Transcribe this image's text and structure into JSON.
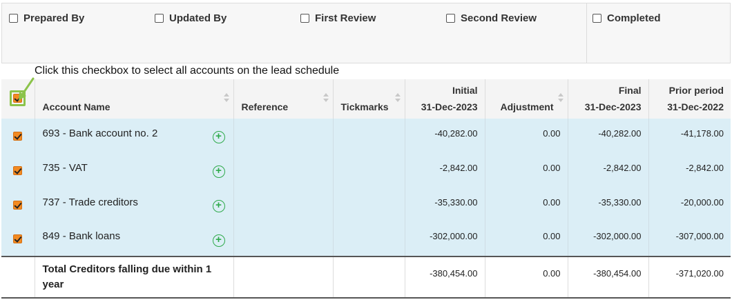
{
  "signoff": {
    "prepared_by": "Prepared By",
    "updated_by": "Updated By",
    "first_review": "First Review",
    "second_review": "Second Review",
    "completed": "Completed"
  },
  "annotation": "Click this checkbox to select all accounts on the lead schedule",
  "colors": {
    "checkbox_checked": "#f28a22",
    "highlight_border": "#8bc34a",
    "row_selected": "#dbeef6",
    "add_icon": "#2eaa4a"
  },
  "table": {
    "headers": {
      "account_name": "Account Name",
      "reference": "Reference",
      "tickmarks": "Tickmarks",
      "initial_l1": "Initial",
      "initial_l2": "31-Dec-2023",
      "adjustment": "Adjustment",
      "final_l1": "Final",
      "final_l2": "31-Dec-2023",
      "prior_l1": "Prior period",
      "prior_l2": "31-Dec-2022"
    },
    "rows": [
      {
        "account": "693 - Bank account no. 2",
        "reference": "",
        "tickmarks": "",
        "initial": "-40,282.00",
        "adjustment": "0.00",
        "final": "-40,282.00",
        "prior": "-41,178.00"
      },
      {
        "account": "735 - VAT",
        "reference": "",
        "tickmarks": "",
        "initial": "-2,842.00",
        "adjustment": "0.00",
        "final": "-2,842.00",
        "prior": "-2,842.00"
      },
      {
        "account": "737 - Trade creditors",
        "reference": "",
        "tickmarks": "",
        "initial": "-35,330.00",
        "adjustment": "0.00",
        "final": "-35,330.00",
        "prior": "-20,000.00"
      },
      {
        "account": "849 - Bank loans",
        "reference": "",
        "tickmarks": "",
        "initial": "-302,000.00",
        "adjustment": "0.00",
        "final": "-302,000.00",
        "prior": "-307,000.00"
      }
    ],
    "total": {
      "label": "Total Creditors falling due within 1 year",
      "initial": "-380,454.00",
      "adjustment": "0.00",
      "final": "-380,454.00",
      "prior": "-371,020.00"
    }
  }
}
